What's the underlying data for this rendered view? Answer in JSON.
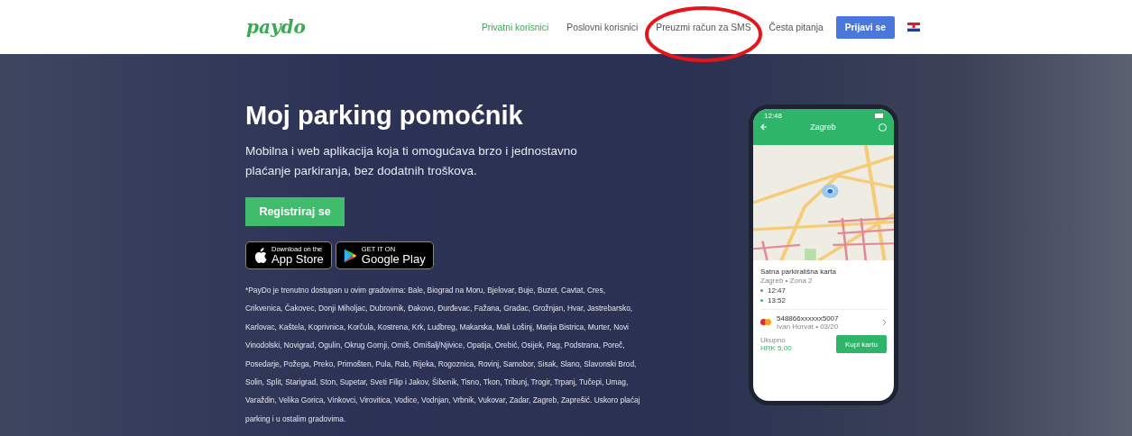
{
  "header": {
    "logo": "paydo",
    "nav": [
      {
        "label": "Privatni korisnici",
        "selected": true
      },
      {
        "label": "Poslovni korisnici",
        "selected": false
      },
      {
        "label": "Preuzmi račun za SMS",
        "selected": false
      },
      {
        "label": "Česta pitanja",
        "selected": false
      }
    ],
    "login_button": "Prijavi se"
  },
  "hero": {
    "title": "Moj parking pomoćnik",
    "subtitle": "Mobilna i web aplikacija koja ti omogućava brzo i jednostavno plaćanje parkiranja, bez dodatnih troškova.",
    "register_button": "Registriraj se",
    "store_badges": [
      {
        "kind": "apple",
        "small": "Download on the",
        "big": "App Store"
      },
      {
        "kind": "google",
        "small": "GET IT ON",
        "big": "Google Play"
      }
    ],
    "cities_note": "*PayDo je trenutno dostupan u ovim gradovima: Bale, Biograd na Moru, Bjelovar, Buje, Buzet, Cavtat, Cres, Crikvenica, Čakovec, Donji Miholjac, Dubrovnik, Đakovo, Đurđevac, Fažana, Gradac, Grožnjan, Hvar, Jastrebarsko, Karlovac, Kaštela, Koprivnica, Korčula, Kostrena, Krk, Ludbreg, Makarska, Mali Lošinj, Marija Bistrica, Murter, Novi Vinodolski, Novigrad, Ogulin, Okrug Gornji, Omiš, Omišalj/Njivice, Opatija, Orebić, Osijek, Pag, Podstrana, Poreč, Posedarje, Požega, Preko, Primošten, Pula, Rab, Rijeka, Rogoznica, Rovinj, Samobor, Sisak, Slano, Slavonski Brod, Solin, Split, Starigrad, Ston, Supetar, Sveti Filip i Jakov, Šibenik, Tisno, Tkon, Tribunj, Trogir, Trpanj, Tučepi, Umag, Varaždin, Velika Gorica, Vinkovci, Virovitica, Vodice, Vodnjan, Vrbnik, Vukovar, Zadar, Zagreb, Zaprešić. Uskoro plaćaj parking i u ostalim gradovima."
  },
  "phone": {
    "time": "12:48",
    "city": "Zagreb",
    "ticket_title": "Satna parkirališna karta",
    "ticket_zone": "Zagreb • Zona 2",
    "times": [
      "12:47",
      "13:52"
    ],
    "card_number": "548866xxxxxx5007",
    "card_owner": "Ivan Horvat • 03/20",
    "total_label": "Ukupno",
    "total": "HRK 5,00",
    "buy_button": "Kupi kartu"
  }
}
